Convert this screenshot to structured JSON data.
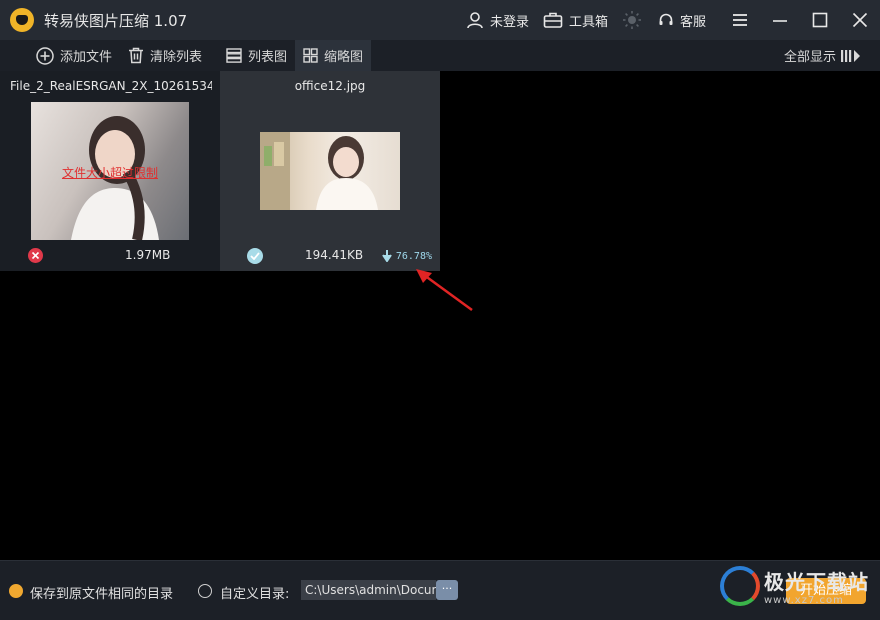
{
  "app": {
    "title": "转易侠图片压缩 1.07",
    "logo_icon": "dog-logo"
  },
  "titlebar": {
    "login_label": "未登录",
    "toolbox_label": "工具箱",
    "service_label": "客服"
  },
  "toolbar": {
    "add_file_label": "添加文件",
    "clear_list_label": "清除列表",
    "list_view_label": "列表图",
    "thumb_view_label": "缩略图",
    "show_all_label": "全部显示"
  },
  "files": [
    {
      "name": "File_2_RealESRGAN_2X_10261534...",
      "overlay_text": "文件大小超过限制",
      "status": "error",
      "size": "1.97MB"
    },
    {
      "name": "office12.jpg",
      "status": "success",
      "size": "194.41KB",
      "ratio": "76.78%"
    }
  ],
  "bottom": {
    "save_original_label": "保存到原文件相同的目录",
    "custom_dir_label": "自定义目录:",
    "path_value": "C:\\Users\\admin\\Docum",
    "browse_label": "···",
    "start_label": "开始压缩"
  },
  "watermark": {
    "main": "极光下载站",
    "sub": "www.xz7.com"
  },
  "colors": {
    "accent": "#f2a52e",
    "error": "#e03030",
    "success": "#a8dbe8",
    "titlebar": "#262b33"
  }
}
